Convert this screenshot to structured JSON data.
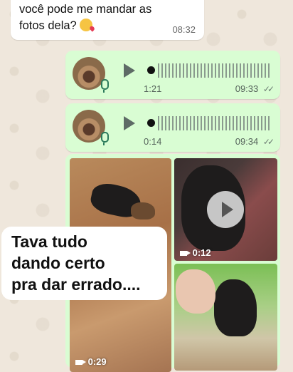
{
  "messages": {
    "incoming": {
      "text": "você pode me mandar as fotos dela?",
      "emoji": "smiling-face-with-hearts",
      "time": "08:32"
    },
    "voice_notes": [
      {
        "duration": "1:21",
        "time": "09:33",
        "status": "read"
      },
      {
        "duration": "0:14",
        "time": "09:34",
        "status": "read"
      }
    ],
    "media": {
      "videos": [
        {
          "duration": "0:29"
        },
        {
          "duration": "0:12"
        }
      ]
    }
  },
  "caption": {
    "lines": [
      "Tava tudo",
      "dando certo",
      "pra dar errado...."
    ]
  },
  "colors": {
    "outgoing_bubble": "#d9fdd3",
    "incoming_bubble": "#ffffff",
    "wallpaper": "#efe7dc"
  }
}
